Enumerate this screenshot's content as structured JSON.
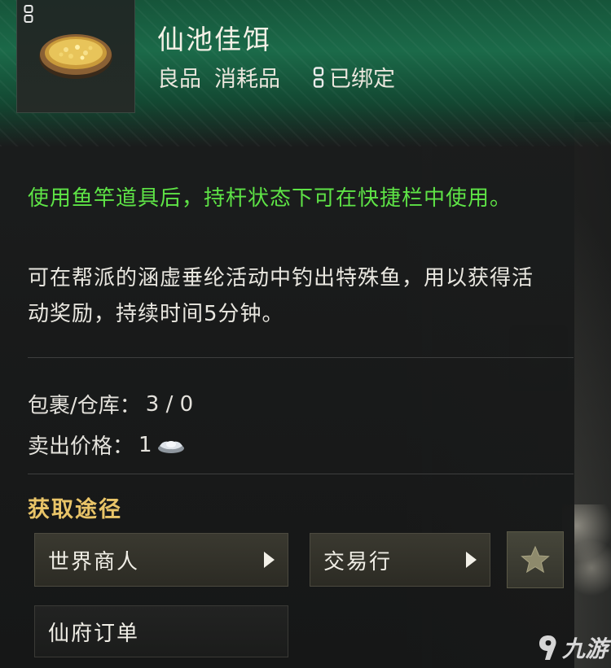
{
  "item": {
    "name": "仙池佳饵",
    "quality": "良品",
    "category": "消耗品",
    "bind_status": "已绑定",
    "icon": "golden-bait-bowl-icon"
  },
  "description": {
    "usage": "使用鱼竿道具后，持杆状态下可在快捷栏中使用。",
    "effect": "可在帮派的涵虚垂纶活动中钓出特殊鱼，用以获得活动奖励，持续时间5分钟。"
  },
  "stats": {
    "storage_label": "包裹/仓库：",
    "storage_value": "3 / 0",
    "price_label": "卖出价格：",
    "price_value": "1",
    "price_icon": "silver-ingot-icon"
  },
  "sources": {
    "title": "获取途径",
    "items": [
      {
        "label": "世界商人"
      },
      {
        "label": "交易行"
      },
      {
        "label": "仙府订单"
      }
    ],
    "favorite_icon": "star-icon"
  },
  "background": {
    "number": "60"
  },
  "watermark": {
    "text": "九游"
  },
  "colors": {
    "header_green": "#1b6a49",
    "usage_text": "#5ee346",
    "section_title": "#e9c468"
  }
}
